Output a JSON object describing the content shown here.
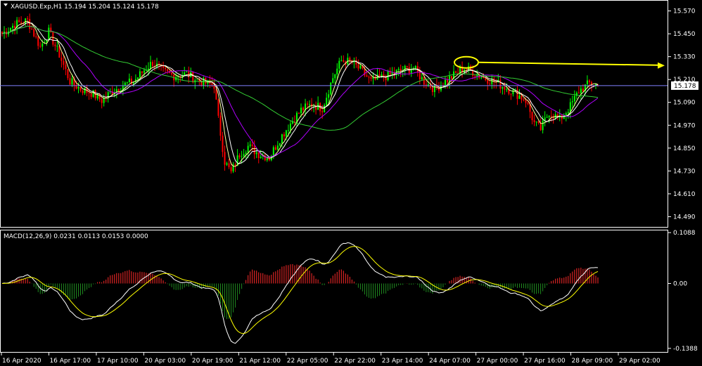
{
  "chart_data": [
    {
      "type": "candlestick",
      "title": "XAGUSD.Exp,H1  15.194 15.204 15.124 15.178",
      "ylim": [
        14.44,
        15.62
      ],
      "yticks": [
        "15.570",
        "15.450",
        "15.330",
        "15.210",
        "15.090",
        "14.970",
        "14.850",
        "14.730",
        "14.610",
        "14.490"
      ],
      "current_price_label": "15.178",
      "current_price": 15.178,
      "anchors": [
        {
          "i": 0,
          "p": 15.45
        },
        {
          "i": 6,
          "p": 15.5
        },
        {
          "i": 12,
          "p": 15.52
        },
        {
          "i": 18,
          "p": 15.38
        },
        {
          "i": 22,
          "p": 15.46
        },
        {
          "i": 27,
          "p": 15.34
        },
        {
          "i": 32,
          "p": 15.2
        },
        {
          "i": 37,
          "p": 15.16
        },
        {
          "i": 42,
          "p": 15.14
        },
        {
          "i": 47,
          "p": 15.1
        },
        {
          "i": 52,
          "p": 15.15
        },
        {
          "i": 57,
          "p": 15.18
        },
        {
          "i": 62,
          "p": 15.2
        },
        {
          "i": 67,
          "p": 15.26
        },
        {
          "i": 71,
          "p": 15.3
        },
        {
          "i": 76,
          "p": 15.25
        },
        {
          "i": 81,
          "p": 15.23
        },
        {
          "i": 87,
          "p": 15.24
        },
        {
          "i": 93,
          "p": 15.2
        },
        {
          "i": 100,
          "p": 15.18
        },
        {
          "i": 102,
          "p": 15.0
        },
        {
          "i": 105,
          "p": 14.78
        },
        {
          "i": 108,
          "p": 14.72
        },
        {
          "i": 112,
          "p": 14.82
        },
        {
          "i": 116,
          "p": 14.86
        },
        {
          "i": 121,
          "p": 14.82
        },
        {
          "i": 126,
          "p": 14.8
        },
        {
          "i": 131,
          "p": 14.9
        },
        {
          "i": 136,
          "p": 14.98
        },
        {
          "i": 141,
          "p": 15.05
        },
        {
          "i": 146,
          "p": 15.08
        },
        {
          "i": 151,
          "p": 15.06
        },
        {
          "i": 156,
          "p": 15.22
        },
        {
          "i": 160,
          "p": 15.31
        },
        {
          "i": 165,
          "p": 15.3
        },
        {
          "i": 169,
          "p": 15.26
        },
        {
          "i": 174,
          "p": 15.2
        },
        {
          "i": 179,
          "p": 15.22
        },
        {
          "i": 184,
          "p": 15.24
        },
        {
          "i": 189,
          "p": 15.26
        },
        {
          "i": 194,
          "p": 15.27
        },
        {
          "i": 199,
          "p": 15.2
        },
        {
          "i": 204,
          "p": 15.16
        },
        {
          "i": 209,
          "p": 15.2
        },
        {
          "i": 214,
          "p": 15.24
        },
        {
          "i": 218,
          "p": 15.27
        },
        {
          "i": 222,
          "p": 15.25
        },
        {
          "i": 227,
          "p": 15.22
        },
        {
          "i": 232,
          "p": 15.2
        },
        {
          "i": 237,
          "p": 15.17
        },
        {
          "i": 242,
          "p": 15.14
        },
        {
          "i": 247,
          "p": 15.1
        },
        {
          "i": 251,
          "p": 14.98
        },
        {
          "i": 254,
          "p": 14.95
        },
        {
          "i": 258,
          "p": 15.04
        },
        {
          "i": 263,
          "p": 15.0
        },
        {
          "i": 268,
          "p": 15.07
        },
        {
          "i": 272,
          "p": 15.15
        },
        {
          "i": 277,
          "p": 15.19
        },
        {
          "i": 281,
          "p": 15.18
        }
      ],
      "bar_count": 282,
      "annotation": {
        "type": "ellipse-and-arrow",
        "price": 15.3,
        "color": "#ffff00"
      }
    },
    {
      "type": "macd",
      "title": "MACD(12,26,9) 0.0231 0.0113 0.0153 0.0000",
      "ylim": [
        -0.145,
        0.112
      ],
      "yticks": [
        "0.1088",
        "0.00",
        "-0.1388"
      ],
      "ytick_values": [
        0.1088,
        0.0,
        -0.1388
      ]
    }
  ],
  "x_axis": {
    "tick_labels": [
      "16 Apr 2020",
      "16 Apr 17:00",
      "17 Apr 10:00",
      "20 Apr 03:00",
      "20 Apr 19:00",
      "21 Apr 12:00",
      "22 Apr 05:00",
      "22 Apr 22:00",
      "23 Apr 14:00",
      "24 Apr 07:00",
      "27 Apr 00:00",
      "27 Apr 16:00",
      "28 Apr 09:00",
      "29 Apr 02:00"
    ]
  },
  "colors": {
    "background": "#000000",
    "bull_candle": "#00ff00",
    "bear_candle": "#ff0000",
    "ma_fast": "#ffff99",
    "ma_white": "#ffffff",
    "ma_mid": "#b000ff",
    "ma_slow": "#33cc33",
    "hist_positive": "#ff2a2a",
    "hist_negative": "#1f8a1f",
    "macd_line": "#ffffff",
    "signal_line": "#ffff00",
    "annotation": "#ffff00",
    "grid": "#ffffff",
    "price_line": "#8080ff"
  },
  "header_icon": "triangle-down-icon"
}
